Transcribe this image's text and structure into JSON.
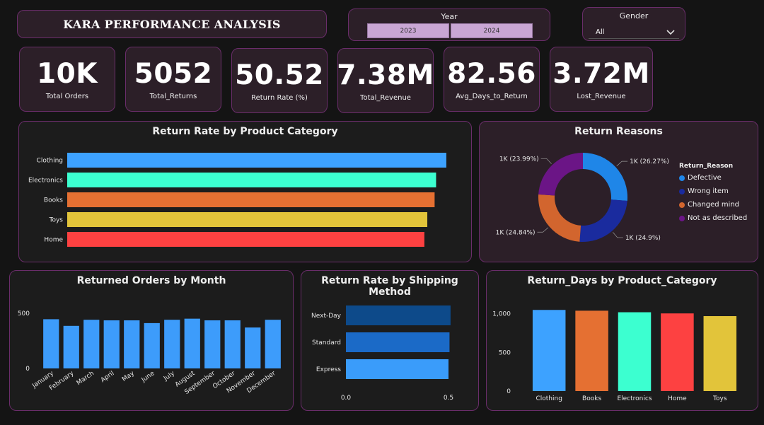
{
  "header": {
    "title": "KARA PERFORMANCE ANALYSIS"
  },
  "year_slicer": {
    "label": "Year",
    "options": [
      "2023",
      "2024"
    ]
  },
  "gender_slicer": {
    "label": "Gender",
    "value": "All"
  },
  "kpis": [
    {
      "value": "10K",
      "label": "Total Orders"
    },
    {
      "value": "5052",
      "label": "Total_Returns"
    },
    {
      "value": "50.52",
      "label": "Return Rate (%)"
    },
    {
      "value": "7.38M",
      "label": "Total_Revenue"
    },
    {
      "value": "82.56",
      "label": "Avg_Days_to_Return"
    },
    {
      "value": "3.72M",
      "label": "Lost_Revenue"
    }
  ],
  "colors": {
    "clothing": "#3da2ff",
    "electronics": "#3cffd0",
    "books": "#e57032",
    "toys": "#e2c43a",
    "home": "#fd4141",
    "defective": "#1f86e8",
    "wrong_item": "#1a2b9e",
    "changed_mind": "#d2652e",
    "not_as_described": "#6b1586",
    "month_bar": "#3d9cfb",
    "next_day": "#0d4a8a",
    "standard": "#1b6ac7",
    "express": "#3a9cfa"
  },
  "chart_data": [
    {
      "type": "bar",
      "orientation": "horizontal",
      "title": "Return Rate by Product Category",
      "categories": [
        "Clothing",
        "Electronics",
        "Books",
        "Toys",
        "Home"
      ],
      "values": [
        51.8,
        50.4,
        50.2,
        49.2,
        48.8
      ],
      "xlim": [
        0,
        52
      ]
    },
    {
      "type": "pie",
      "subtype": "donut",
      "title": "Return Reasons",
      "legend_title": "Return_Reason",
      "categories": [
        "Defective",
        "Wrong item",
        "Changed mind",
        "Not as described"
      ],
      "values": [
        26.27,
        24.9,
        24.84,
        23.99
      ],
      "labels": [
        "1K (26.27%)",
        "1K (24.9%)",
        "1K (24.84%)",
        "1K (23.99%)"
      ],
      "legend": "right"
    },
    {
      "type": "bar",
      "title": "Returned Orders by Month",
      "categories": [
        "January",
        "February",
        "March",
        "April",
        "May",
        "June",
        "July",
        "August",
        "September",
        "October",
        "November",
        "December"
      ],
      "values": [
        445,
        385,
        440,
        435,
        435,
        410,
        440,
        450,
        435,
        435,
        370,
        440
      ],
      "yticks": [
        "0",
        "500"
      ],
      "ylim": [
        0,
        550
      ]
    },
    {
      "type": "bar",
      "orientation": "horizontal",
      "title": "Return Rate by Shipping Method",
      "categories": [
        "Next-Day",
        "Standard",
        "Express"
      ],
      "values": [
        0.51,
        0.505,
        0.5
      ],
      "xticks": [
        "0.0",
        "0.5"
      ],
      "xlim": [
        0,
        0.5
      ]
    },
    {
      "type": "bar",
      "title": "Return_Days by Product_Category",
      "categories": [
        "Clothing",
        "Books",
        "Electronics",
        "Home",
        "Toys"
      ],
      "values": [
        1050,
        1040,
        1020,
        1005,
        970
      ],
      "yticks": [
        "0",
        "500",
        "1,000"
      ],
      "ylim": [
        0,
        1080
      ]
    }
  ]
}
